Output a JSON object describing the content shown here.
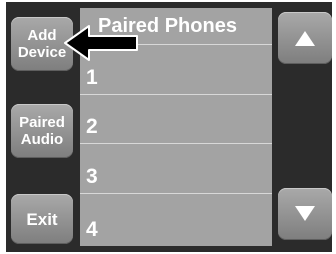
{
  "side_buttons": {
    "add_device_line1": "Add",
    "add_device_line2": "Device",
    "paired_audio_line1": "Paired",
    "paired_audio_line2": "Audio",
    "exit": "Exit"
  },
  "list": {
    "header": "Paired Phones",
    "rows": [
      {
        "number": "1"
      },
      {
        "number": "2"
      },
      {
        "number": "3"
      },
      {
        "number": "4"
      }
    ]
  },
  "scroll": {
    "up_icon": "triangle-up-icon",
    "down_icon": "triangle-down-icon"
  },
  "colors": {
    "panel": "#2b2b2b",
    "button": "#8f8f8f",
    "list": "#a3a3a3",
    "text": "#ffffff"
  }
}
